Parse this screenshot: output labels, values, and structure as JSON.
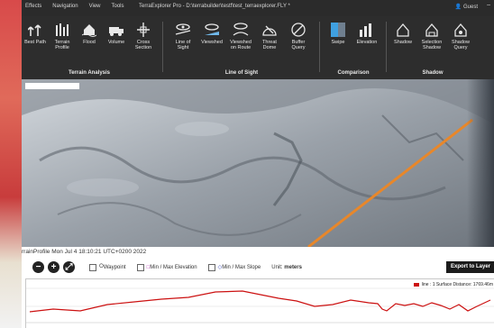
{
  "titlebar": {
    "menu": [
      "Effects",
      "Navigation",
      "View",
      "Tools"
    ],
    "title": "TerraExplorer Pro - D:\\terrabuilder\\testf\\test_terraexplorer.FLY *",
    "user": "Guest",
    "win_controls": "–"
  },
  "ribbon": {
    "terrain_analysis": {
      "label": "Terrain Analysis",
      "buttons": [
        "Best Path",
        "Terrain Profile",
        "Flood",
        "Volume",
        "Cross Section"
      ]
    },
    "line_of_sight": {
      "label": "Line of Sight",
      "buttons": [
        "Line of Sight",
        "Viewshed",
        "Viewshed on Route",
        "Threat Dome",
        "Buffer Query"
      ]
    },
    "comparison": {
      "label": "Comparison",
      "buttons": [
        "Swipe",
        "Elevation"
      ]
    },
    "shadow": {
      "label": "Shadow",
      "buttons": [
        "Shadow",
        "Selection Shadow",
        "Shadow Query"
      ]
    }
  },
  "profile": {
    "status": "rrainProfile Mon Jul 4 18:10:21 UTC+0200 2022",
    "waypoint_label": "Waypoint",
    "minmax_elev_label": "Min / Max Elevation",
    "minmax_slope_label": "Min / Max Slope",
    "unit_label": "Unit:",
    "unit_value": "meters",
    "export_label": "Export to Layer",
    "legend_text": "line : 1 Surface Distance: 1769.46m",
    "line_color": "#cc1111"
  },
  "colors": {
    "ribbon_bg": "#2d2d2d",
    "route_line": "#e8872a"
  }
}
